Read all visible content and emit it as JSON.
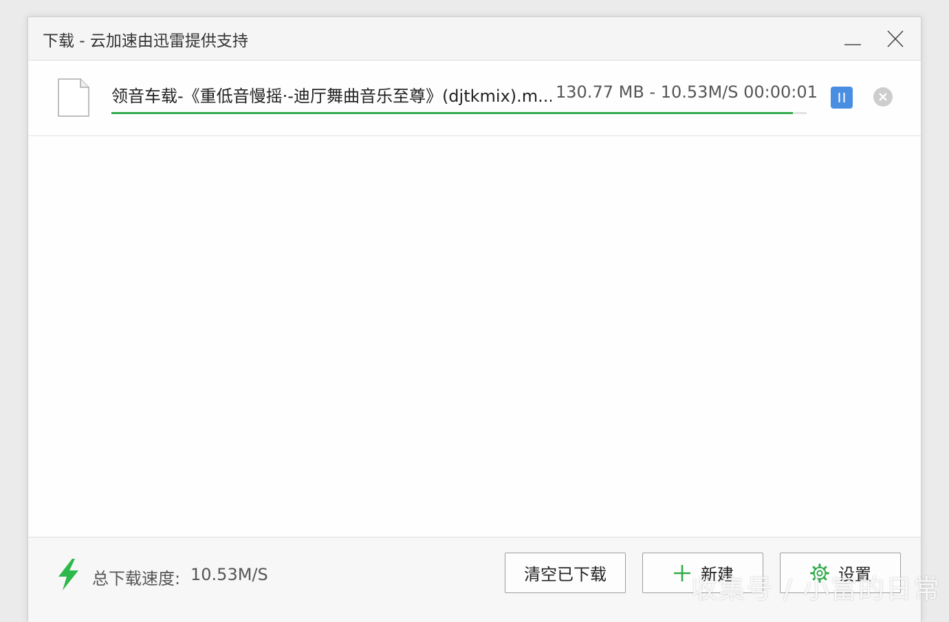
{
  "window": {
    "title": "下载 - 云加速由迅雷提供支持"
  },
  "task": {
    "file_icon": "file-icon",
    "file_name": "领音车载-《重低音慢摇·-迪厅舞曲音乐至尊》(djtkmix).m...",
    "size": "130.77 MB",
    "separator": "-",
    "speed": "10.53M/S",
    "time": "00:00:01",
    "progress_percent": 98,
    "progress_color": "#2fab4b",
    "pause_icon": "pause-icon",
    "remove_icon": "close-circle-icon"
  },
  "footer": {
    "speed_icon": "lightning-bolt-icon",
    "total_speed_label": "总下载速度:",
    "total_speed_value": "10.53M/S",
    "clear_button": "清空已下载",
    "new_button": "新建",
    "new_icon": "plus-icon",
    "settings_button": "设置",
    "settings_icon": "gear-icon"
  },
  "watermark": "收集号 / 小富的日常",
  "colors": {
    "accent_green": "#2fab4b",
    "pause_blue": "#4a8ee2"
  }
}
